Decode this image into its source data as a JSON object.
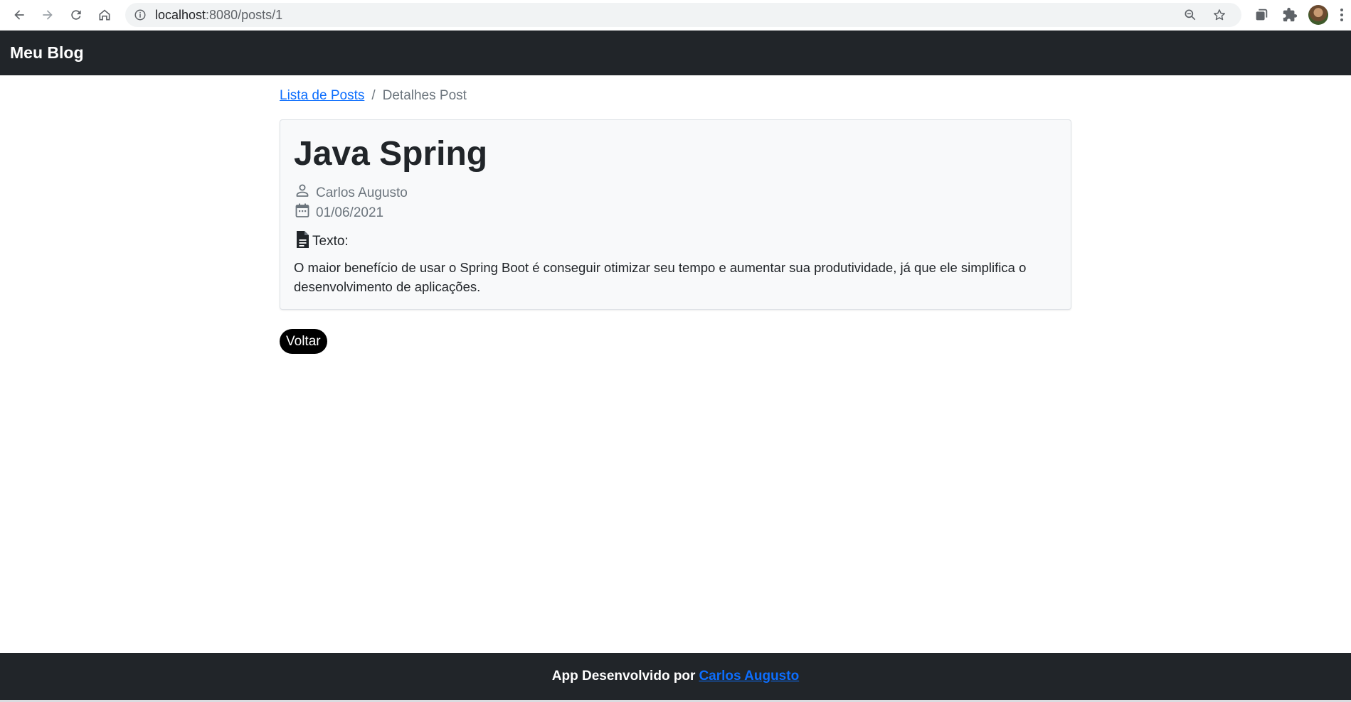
{
  "browser": {
    "url_host": "localhost",
    "url_rest": ":8080/posts/1",
    "icons": [
      "back-icon",
      "forward-icon",
      "reload-icon",
      "home-icon",
      "info-icon",
      "zoom-icon",
      "star-icon",
      "tab-search-icon",
      "extensions-icon",
      "profile-avatar",
      "menu-icon"
    ]
  },
  "navbar": {
    "brand": "Meu Blog"
  },
  "breadcrumb": {
    "link": "Lista de Posts",
    "separator": "/",
    "current": "Detalhes Post"
  },
  "post": {
    "title": "Java Spring",
    "author": "Carlos Augusto",
    "date": "01/06/2021",
    "text_label": "Texto:",
    "body": "O maior benefício de usar o Spring Boot é conseguir otimizar seu tempo e aumentar sua produtividade, já que ele simplifica o desenvolvimento de aplicações."
  },
  "actions": {
    "back_label": "Voltar"
  },
  "footer": {
    "prefix": "App Desenvolvido por",
    "author_link": "Carlos Augusto"
  },
  "colors": {
    "navbar_bg": "#212529",
    "link": "#0d6efd",
    "card_bg": "#f8f9fa",
    "muted": "#6c757d"
  }
}
